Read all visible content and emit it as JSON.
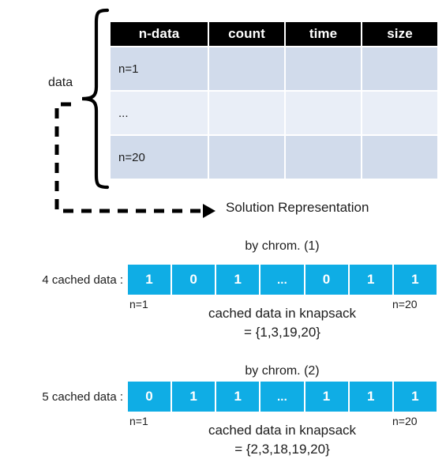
{
  "table": {
    "headers": [
      "n-data",
      "count",
      "time",
      "size"
    ],
    "rows": [
      {
        "label": "n=1",
        "shade": "row-shade"
      },
      {
        "label": "...",
        "shade": "row-light"
      },
      {
        "label": "n=20",
        "shade": "row-shade"
      }
    ]
  },
  "brace": {
    "label": "data"
  },
  "flow": {
    "solution_label": "Solution Representation"
  },
  "chromosomes": [
    {
      "title": "by chrom. (1)",
      "side_label": "4 cached data :",
      "genes": [
        "1",
        "0",
        "1",
        "...",
        "0",
        "1",
        "1"
      ],
      "tick_left": "n=1",
      "tick_right": "n=20",
      "caption_line1": "cached data in knapsack",
      "caption_line2": "= {1,3,19,20}"
    },
    {
      "title": "by chrom. (2)",
      "side_label": "5 cached data :",
      "genes": [
        "0",
        "1",
        "1",
        "...",
        "1",
        "1",
        "1"
      ],
      "tick_left": "n=1",
      "tick_right": "n=20",
      "caption_line1": "cached data in knapsack",
      "caption_line2": "= {2,3,18,19,20}"
    }
  ],
  "colors": {
    "gene_fill": "#0fade5",
    "header_fill": "#000000",
    "row_shade": "#d1dbeb",
    "row_light": "#e9eef7",
    "ink": "#1c1c1c"
  }
}
